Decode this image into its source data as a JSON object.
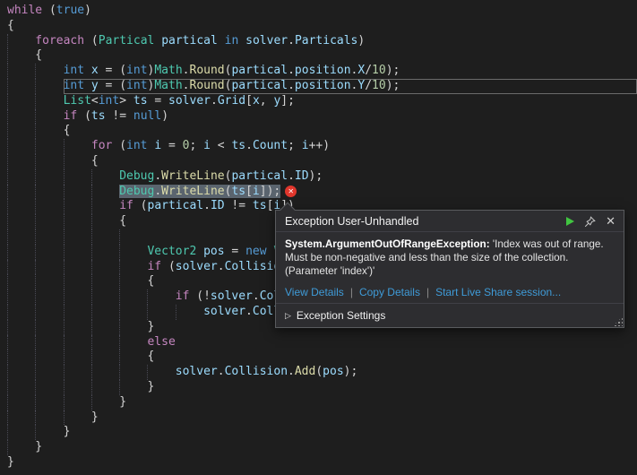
{
  "editor": {
    "background": "#1e1e1e",
    "colors": {
      "keyword": "#569cd6",
      "control_keyword": "#c586c0",
      "type": "#4ec9b0",
      "method": "#dcdcaa",
      "variable": "#9cdcfe",
      "number": "#b5cea8",
      "punctuation": "#d4d4d4",
      "exception_highlight": "#5a646e",
      "error_icon": "#e0362c"
    }
  },
  "code": {
    "lines": [
      {
        "i": 0,
        "s": [
          [
            "c",
            "while"
          ],
          [
            "p",
            " ("
          ],
          [
            "k",
            "true"
          ],
          [
            "p",
            ")"
          ]
        ]
      },
      {
        "i": 0,
        "s": [
          [
            "p",
            "{"
          ]
        ]
      },
      {
        "i": 1,
        "s": [
          [
            "c",
            "foreach"
          ],
          [
            "p",
            " ("
          ],
          [
            "t",
            "Partical"
          ],
          [
            "p",
            " "
          ],
          [
            "v",
            "partical"
          ],
          [
            "p",
            " "
          ],
          [
            "k",
            "in"
          ],
          [
            "p",
            " "
          ],
          [
            "v",
            "solver"
          ],
          [
            "p",
            "."
          ],
          [
            "v",
            "Particals"
          ],
          [
            "p",
            ")"
          ]
        ]
      },
      {
        "i": 1,
        "s": [
          [
            "p",
            "{"
          ]
        ]
      },
      {
        "i": 2,
        "s": [
          [
            "k",
            "int"
          ],
          [
            "p",
            " "
          ],
          [
            "v",
            "x"
          ],
          [
            "p",
            " = ("
          ],
          [
            "k",
            "int"
          ],
          [
            "p",
            ")"
          ],
          [
            "t",
            "Math"
          ],
          [
            "p",
            "."
          ],
          [
            "m",
            "Round"
          ],
          [
            "p",
            "("
          ],
          [
            "v",
            "partical"
          ],
          [
            "p",
            "."
          ],
          [
            "v",
            "position"
          ],
          [
            "p",
            "."
          ],
          [
            "v",
            "X"
          ],
          [
            "p",
            "/"
          ],
          [
            "n",
            "10"
          ],
          [
            "p",
            ");"
          ]
        ]
      },
      {
        "i": 2,
        "cur": true,
        "s": [
          [
            "k",
            "int"
          ],
          [
            "p",
            " "
          ],
          [
            "v",
            "y"
          ],
          [
            "p",
            " = ("
          ],
          [
            "k",
            "int"
          ],
          [
            "p",
            ")"
          ],
          [
            "t",
            "Math"
          ],
          [
            "p",
            "."
          ],
          [
            "m",
            "Round"
          ],
          [
            "p",
            "("
          ],
          [
            "v",
            "partical"
          ],
          [
            "p",
            "."
          ],
          [
            "v",
            "position"
          ],
          [
            "p",
            "."
          ],
          [
            "v",
            "Y"
          ],
          [
            "p",
            "/"
          ],
          [
            "n",
            "10"
          ],
          [
            "p",
            ");"
          ]
        ]
      },
      {
        "i": 2,
        "s": [
          [
            "t",
            "List"
          ],
          [
            "p",
            "<"
          ],
          [
            "k",
            "int"
          ],
          [
            "p",
            "> "
          ],
          [
            "v",
            "ts"
          ],
          [
            "p",
            " = "
          ],
          [
            "v",
            "solver"
          ],
          [
            "p",
            "."
          ],
          [
            "v",
            "Grid"
          ],
          [
            "p",
            "["
          ],
          [
            "v",
            "x"
          ],
          [
            "p",
            ", "
          ],
          [
            "v",
            "y"
          ],
          [
            "p",
            "];"
          ]
        ]
      },
      {
        "i": 2,
        "s": [
          [
            "c",
            "if"
          ],
          [
            "p",
            " ("
          ],
          [
            "v",
            "ts"
          ],
          [
            "p",
            " != "
          ],
          [
            "k",
            "null"
          ],
          [
            "p",
            ")"
          ]
        ]
      },
      {
        "i": 2,
        "s": [
          [
            "p",
            "{"
          ]
        ]
      },
      {
        "i": 3,
        "s": [
          [
            "c",
            "for"
          ],
          [
            "p",
            " ("
          ],
          [
            "k",
            "int"
          ],
          [
            "p",
            " "
          ],
          [
            "v",
            "i"
          ],
          [
            "p",
            " = "
          ],
          [
            "n",
            "0"
          ],
          [
            "p",
            "; "
          ],
          [
            "v",
            "i"
          ],
          [
            "p",
            " < "
          ],
          [
            "v",
            "ts"
          ],
          [
            "p",
            "."
          ],
          [
            "v",
            "Count"
          ],
          [
            "p",
            "; "
          ],
          [
            "v",
            "i"
          ],
          [
            "p",
            "++)"
          ]
        ]
      },
      {
        "i": 3,
        "s": [
          [
            "p",
            "{"
          ]
        ]
      },
      {
        "i": 4,
        "s": [
          [
            "t",
            "Debug"
          ],
          [
            "p",
            "."
          ],
          [
            "m",
            "WriteLine"
          ],
          [
            "p",
            "("
          ],
          [
            "v",
            "partical"
          ],
          [
            "p",
            "."
          ],
          [
            "v",
            "ID"
          ],
          [
            "p",
            ");"
          ]
        ]
      },
      {
        "i": 4,
        "hl": true,
        "err": true,
        "s": [
          [
            "t",
            "Debug"
          ],
          [
            "p",
            "."
          ],
          [
            "m",
            "WriteLine"
          ],
          [
            "p",
            "("
          ],
          [
            "v",
            "ts"
          ],
          [
            "p",
            "["
          ],
          [
            "v",
            "i"
          ],
          [
            "p",
            "]);"
          ]
        ]
      },
      {
        "i": 4,
        "s": [
          [
            "c",
            "if"
          ],
          [
            "p",
            " ("
          ],
          [
            "v",
            "partical"
          ],
          [
            "p",
            "."
          ],
          [
            "v",
            "ID"
          ],
          [
            "p",
            " != "
          ],
          [
            "v",
            "ts"
          ],
          [
            "p",
            "["
          ],
          [
            "v",
            "i"
          ],
          [
            "p",
            "])"
          ]
        ]
      },
      {
        "i": 4,
        "s": [
          [
            "p",
            "{"
          ]
        ]
      },
      {
        "i": 5,
        "s": []
      },
      {
        "i": 5,
        "s": [
          [
            "t",
            "Vector2"
          ],
          [
            "p",
            " "
          ],
          [
            "v",
            "pos"
          ],
          [
            "p",
            " = "
          ],
          [
            "k",
            "new"
          ],
          [
            "p",
            " "
          ],
          [
            "t",
            "Ve"
          ]
        ]
      },
      {
        "i": 5,
        "s": [
          [
            "c",
            "if"
          ],
          [
            "p",
            " ("
          ],
          [
            "v",
            "solver"
          ],
          [
            "p",
            "."
          ],
          [
            "v",
            "Collision"
          ]
        ]
      },
      {
        "i": 5,
        "s": [
          [
            "p",
            "{"
          ]
        ]
      },
      {
        "i": 6,
        "s": [
          [
            "c",
            "if"
          ],
          [
            "p",
            " (!"
          ],
          [
            "v",
            "solver"
          ],
          [
            "p",
            "."
          ],
          [
            "v",
            "Coll"
          ]
        ]
      },
      {
        "i": 7,
        "s": [
          [
            "v",
            "solver"
          ],
          [
            "p",
            "."
          ],
          [
            "v",
            "Colli"
          ]
        ]
      },
      {
        "i": 5,
        "s": [
          [
            "p",
            "}"
          ]
        ]
      },
      {
        "i": 5,
        "s": [
          [
            "c",
            "else"
          ]
        ]
      },
      {
        "i": 5,
        "s": [
          [
            "p",
            "{"
          ]
        ]
      },
      {
        "i": 6,
        "s": [
          [
            "v",
            "solver"
          ],
          [
            "p",
            "."
          ],
          [
            "v",
            "Collision"
          ],
          [
            "p",
            "."
          ],
          [
            "m",
            "Add"
          ],
          [
            "p",
            "("
          ],
          [
            "v",
            "pos"
          ],
          [
            "p",
            ");"
          ]
        ]
      },
      {
        "i": 5,
        "s": [
          [
            "p",
            "}"
          ]
        ]
      },
      {
        "i": 4,
        "s": [
          [
            "p",
            "}"
          ]
        ]
      },
      {
        "i": 3,
        "s": [
          [
            "p",
            "}"
          ]
        ]
      },
      {
        "i": 2,
        "s": [
          [
            "p",
            "}"
          ]
        ]
      },
      {
        "i": 1,
        "s": [
          [
            "p",
            "}"
          ]
        ]
      },
      {
        "i": 0,
        "s": [
          [
            "p",
            "}"
          ]
        ]
      }
    ]
  },
  "popup": {
    "title": "Exception User-Unhandled",
    "exception_type": "System.ArgumentOutOfRangeException:",
    "message": "'Index was out of range. Must be non-negative and less than the size of the collection. (Parameter 'index')'",
    "links": [
      "View Details",
      "Copy Details",
      "Start Live Share session..."
    ],
    "separator": "|",
    "settings_label": "Exception Settings",
    "expander_glyph": "▷",
    "close_glyph": "✕"
  }
}
